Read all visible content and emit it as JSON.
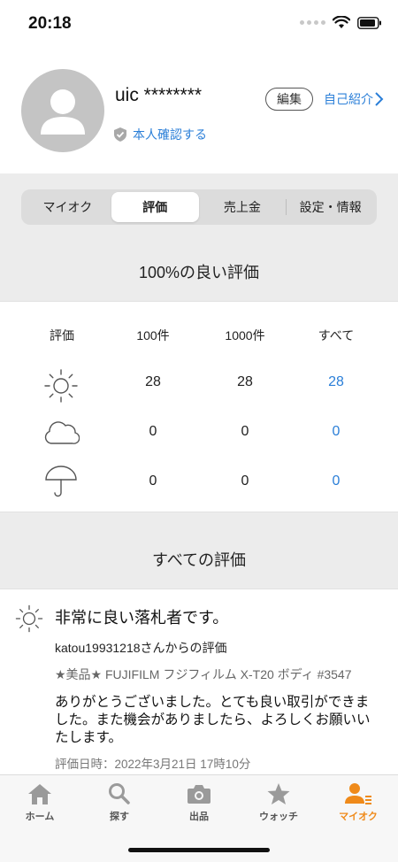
{
  "status_bar": {
    "time": "20:18"
  },
  "profile": {
    "user_name": "uic ********",
    "edit_label": "編集",
    "intro_label": "自己紹介",
    "verify_label": "本人確認する"
  },
  "tabs": [
    {
      "label": "マイオク"
    },
    {
      "label": "評価"
    },
    {
      "label": "売上金"
    },
    {
      "label": "設定・情報"
    }
  ],
  "active_tab": "評価",
  "rating_summary": {
    "title": "100%の良い評価",
    "columns": [
      "評価",
      "100件",
      "1000件",
      "すべて"
    ],
    "rows": [
      {
        "type": "sun-icon",
        "values": [
          "28",
          "28",
          "28"
        ]
      },
      {
        "type": "cloud-icon",
        "values": [
          "0",
          "0",
          "0"
        ]
      },
      {
        "type": "umbrella-icon",
        "values": [
          "0",
          "0",
          "0"
        ]
      }
    ]
  },
  "all_reviews": {
    "title": "すべての評価",
    "review": {
      "title": "非常に良い落札者です。",
      "from": "katou19931218さんからの評価",
      "item": "★美品★ FUJIFILM フジフィルム X-T20 ボディ #3547",
      "body": "ありがとうございました。とても良い取引ができました。また機会がありましたら、よろしくお願いいたします。",
      "date": "評価日時：2022年3月21日 17時10分"
    }
  },
  "bottom_nav": [
    {
      "label": "ホーム",
      "icon": "home-icon"
    },
    {
      "label": "探す",
      "icon": "search-icon"
    },
    {
      "label": "出品",
      "icon": "camera-icon"
    },
    {
      "label": "ウォッチ",
      "icon": "star-icon"
    },
    {
      "label": "マイオク",
      "icon": "person-icon"
    }
  ],
  "colors": {
    "link": "#2b7fd8",
    "accent": "#ef8a1a",
    "nav_inactive": "#9a9a9a"
  }
}
